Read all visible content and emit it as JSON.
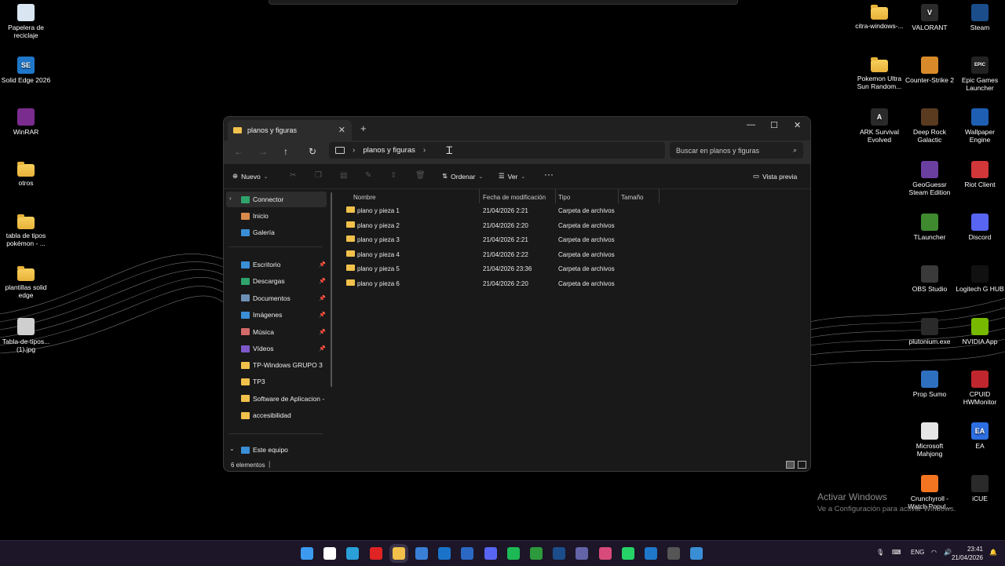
{
  "desktop_left": [
    {
      "label": "Papelera de reciclaje",
      "icon": "recycle-bin-icon",
      "color": "#d9e6f2"
    },
    {
      "label": "Solid Edge 2026",
      "icon": "solid-edge-icon",
      "color": "#1f77c9",
      "glyph": "SE"
    },
    {
      "label": "WinRAR",
      "icon": "winrar-icon",
      "color": "#7b2c8f"
    },
    {
      "label": "otros",
      "icon": "folder-icon",
      "color": "folder"
    },
    {
      "label": "tabla de tipos pokémon - ...",
      "icon": "folder-icon",
      "color": "folder"
    },
    {
      "label": "plantillas solid edge",
      "icon": "folder-icon",
      "color": "folder"
    },
    {
      "label": "Tabla-de-tipos... (1).jpg",
      "icon": "image-file-icon",
      "color": "#cfcfcf"
    }
  ],
  "desktop_right": [
    {
      "label": "citra-windows-...",
      "icon": "folder-icon",
      "color": "folder"
    },
    {
      "label": "VALORANT",
      "icon": "valorant-icon",
      "color": "#2b2b2b",
      "glyph": "V"
    },
    {
      "label": "Steam",
      "icon": "steam-icon",
      "color": "#1b4d8a"
    },
    {
      "label": "Pokemon Ultra Sun Random...",
      "icon": "folder-icon",
      "color": "folder"
    },
    {
      "label": "Counter-Strike 2",
      "icon": "cs2-icon",
      "color": "#d88a2a"
    },
    {
      "label": "Epic Games Launcher",
      "icon": "epic-games-icon",
      "color": "#222",
      "glyph": "EPIC"
    },
    {
      "label": "ARK Survival Evolved",
      "icon": "ark-icon",
      "color": "#2a2a2a",
      "glyph": "A"
    },
    {
      "label": "Deep Rock Galactic",
      "icon": "deep-rock-icon",
      "color": "#5a3b20"
    },
    {
      "label": "Wallpaper Engine",
      "icon": "wallpaper-engine-icon",
      "color": "#1f5fb3"
    },
    {
      "label": "GeoGuessr Steam Edition",
      "icon": "geoguessr-icon",
      "color": "#6b3fa0"
    },
    {
      "label": "Riot Client",
      "icon": "riot-client-icon",
      "color": "#d13639"
    },
    {
      "label": "TLauncher",
      "icon": "tlauncher-icon",
      "color": "#3f8a2f"
    },
    {
      "label": "Discord",
      "icon": "discord-icon",
      "color": "#5865f2"
    },
    {
      "label": "OBS Studio",
      "icon": "obs-icon",
      "color": "#3a3a3a"
    },
    {
      "label": "Logitech G HUB",
      "icon": "logitech-icon",
      "color": "#111"
    },
    {
      "label": "plutonium.exe",
      "icon": "plutonium-icon",
      "color": "#2a2a2a"
    },
    {
      "label": "NVIDIA App",
      "icon": "nvidia-icon",
      "color": "#76b900"
    },
    {
      "label": "Prop Sumo",
      "icon": "prop-sumo-icon",
      "color": "#2f6fbf"
    },
    {
      "label": "CPUID HWMonitor",
      "icon": "hwmonitor-icon",
      "color": "#c0262d"
    },
    {
      "label": "Microsoft Mahjong",
      "icon": "mahjong-icon",
      "color": "#e6e6e6"
    },
    {
      "label": "EA",
      "icon": "ea-icon",
      "color": "#2d6ee0",
      "glyph": "EA"
    },
    {
      "label": "Crunchyroll - Watch Popul...",
      "icon": "crunchyroll-icon",
      "color": "#f47521"
    },
    {
      "label": "iCUE",
      "icon": "icue-icon",
      "color": "#2a2a2a"
    }
  ],
  "window": {
    "tab_title": "planos y figuras",
    "address": "planos y figuras",
    "search_placeholder": "Buscar en planos y figuras",
    "cmd": {
      "new": "Nuevo",
      "sort": "Ordenar",
      "view": "Ver",
      "preview": "Vista previa"
    },
    "sidebar": {
      "connector": "Connector",
      "home": "Inicio",
      "gallery": "Galería",
      "pinned": [
        {
          "label": "Escritorio",
          "color": "#3a8ed6"
        },
        {
          "label": "Descargas",
          "color": "#2fa36b"
        },
        {
          "label": "Documentos",
          "color": "#6e8fb5"
        },
        {
          "label": "Imágenes",
          "color": "#3a8ed6"
        },
        {
          "label": "Música",
          "color": "#d46a6a"
        },
        {
          "label": "Vídeos",
          "color": "#7e58c9"
        }
      ],
      "folders": [
        "TP-Windows GRUPO 3",
        "TP3",
        "Software de Aplicacion - EJ",
        "accesibilidad"
      ],
      "this_pc": "Este equipo"
    },
    "columns": {
      "name": "Nombre",
      "modified": "Fecha de modificación",
      "type": "Tipo",
      "size": "Tamaño"
    },
    "rows": [
      {
        "name": "plano y pieza 1",
        "modified": "21/04/2026 2:21",
        "type": "Carpeta de archivos"
      },
      {
        "name": "plano y pieza 2",
        "modified": "21/04/2026 2:20",
        "type": "Carpeta de archivos"
      },
      {
        "name": "plano y pieza 3",
        "modified": "21/04/2026 2:21",
        "type": "Carpeta de archivos"
      },
      {
        "name": "plano y pieza 4",
        "modified": "21/04/2026 2:22",
        "type": "Carpeta de archivos"
      },
      {
        "name": "plano y pieza 5",
        "modified": "21/04/2026 23:36",
        "type": "Carpeta de archivos"
      },
      {
        "name": "plano y pieza 6",
        "modified": "21/04/2026 2:20",
        "type": "Carpeta de archivos"
      }
    ],
    "status": "6 elementos"
  },
  "watermark": {
    "title": "Activar Windows",
    "subtitle": "Ve a Configuración para activar Windows."
  },
  "taskbar": {
    "apps": [
      {
        "icon": "start-icon",
        "color": "#3c9bf0"
      },
      {
        "icon": "search-icon",
        "color": "#ffffff"
      },
      {
        "icon": "edge-icon",
        "color": "#2a9fd8"
      },
      {
        "icon": "youtube-icon",
        "color": "#e02424"
      },
      {
        "icon": "file-explorer-icon",
        "color": "#f1c14b"
      },
      {
        "icon": "store-icon",
        "color": "#3a7fd6"
      },
      {
        "icon": "outlook-icon",
        "color": "#1a73c9"
      },
      {
        "icon": "word-icon",
        "color": "#2b68c4"
      },
      {
        "icon": "discord-icon",
        "color": "#5865f2"
      },
      {
        "icon": "spotify-icon",
        "color": "#1db954"
      },
      {
        "icon": "xbox-icon",
        "color": "#2c9a3c"
      },
      {
        "icon": "steam-icon",
        "color": "#1b4d8a"
      },
      {
        "icon": "teams-icon",
        "color": "#6264a7"
      },
      {
        "icon": "snipping-icon",
        "color": "#d84a7a"
      },
      {
        "icon": "whatsapp-icon",
        "color": "#25d366"
      },
      {
        "icon": "solid-edge-icon",
        "color": "#1f77c9"
      },
      {
        "icon": "obs-icon",
        "color": "#555555"
      },
      {
        "icon": "paint-icon",
        "color": "#3a8ed6"
      }
    ],
    "lang": "ENG",
    "time": "23:41",
    "date": "21/04/2026"
  }
}
